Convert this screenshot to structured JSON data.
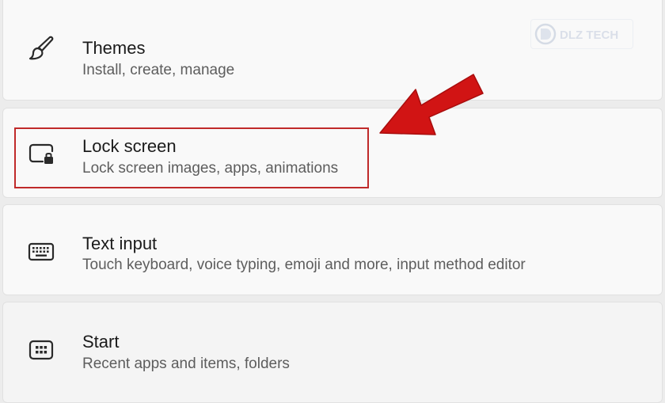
{
  "settings": {
    "items": [
      {
        "title": "Themes",
        "description": "Install, create, manage",
        "icon": "brush-icon"
      },
      {
        "title": "Lock screen",
        "description": "Lock screen images, apps, animations",
        "icon": "lock-screen-icon"
      },
      {
        "title": "Text input",
        "description": "Touch keyboard, voice typing, emoji and more, input method editor",
        "icon": "keyboard-icon"
      },
      {
        "title": "Start",
        "description": "Recent apps and items, folders",
        "icon": "start-icon"
      }
    ]
  },
  "annotation": {
    "highlight_color": "#c02a2a",
    "arrow_color": "#d11414"
  },
  "watermark": {
    "text": "DLZ TECH"
  }
}
